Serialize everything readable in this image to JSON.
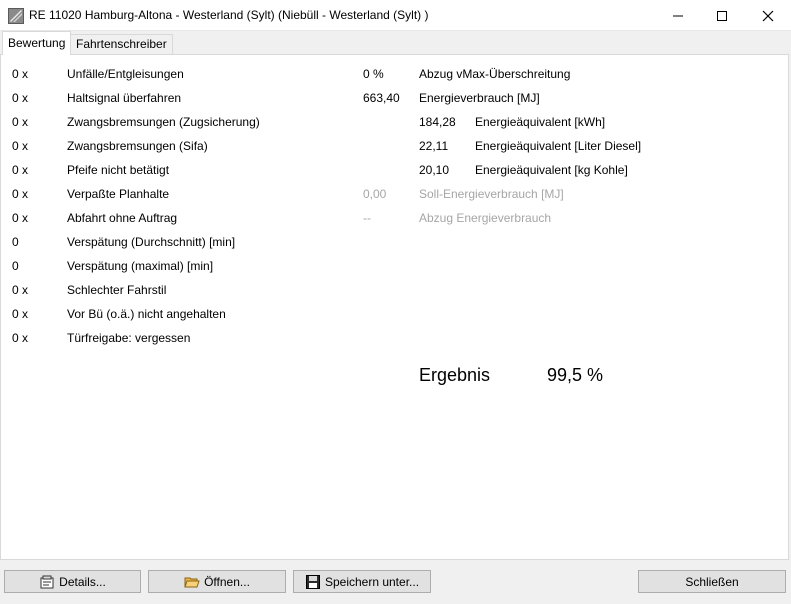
{
  "window": {
    "title": "RE 11020 Hamburg-Altona - Westerland (Sylt) (Niebüll - Westerland (Sylt) )"
  },
  "tabs": [
    {
      "label": "Bewertung",
      "active": true
    },
    {
      "label": "Fahrtenschreiber",
      "active": false
    }
  ],
  "left_rows": [
    {
      "count": "0 x",
      "label": "Unfälle/Entgleisungen"
    },
    {
      "count": "0 x",
      "label": "Haltsignal überfahren"
    },
    {
      "count": "0 x",
      "label": "Zwangsbremsungen (Zugsicherung)"
    },
    {
      "count": "0 x",
      "label": "Zwangsbremsungen (Sifa)"
    },
    {
      "count": "0 x",
      "label": "Pfeife nicht betätigt"
    },
    {
      "count": "0 x",
      "label": "Verpaßte Planhalte"
    },
    {
      "count": "0 x",
      "label": "Abfahrt ohne Auftrag"
    },
    {
      "count": "0",
      "label": "Verspätung (Durchschnitt) [min]"
    },
    {
      "count": "0",
      "label": "Verspätung (maximal) [min]"
    },
    {
      "count": "0 x",
      "label": "Schlechter Fahrstil"
    },
    {
      "count": "0 x",
      "label": "Vor Bü (o.ä.) nicht angehalten"
    },
    {
      "count": "0 x",
      "label": "Türfreigabe: vergessen"
    }
  ],
  "right_rows": [
    {
      "value": "0 %",
      "label": "Abzug vMax-Überschreitung",
      "disabled": false
    },
    {
      "value": "663,40",
      "label": "Energieverbrauch [MJ]",
      "disabled": false
    },
    {
      "value": "",
      "sub_value": "184,28",
      "label": "Energieäquivalent [kWh]",
      "disabled": false
    },
    {
      "value": "",
      "sub_value": "22,11",
      "label": "Energieäquivalent [Liter Diesel]",
      "disabled": false
    },
    {
      "value": "",
      "sub_value": "20,10",
      "label": "Energieäquivalent [kg Kohle]",
      "disabled": false
    },
    {
      "value": "0,00",
      "label": "Soll-Energieverbrauch [MJ]",
      "disabled": true
    },
    {
      "value": "--",
      "label": "Abzug Energieverbrauch",
      "disabled": true
    }
  ],
  "result": {
    "label": "Ergebnis",
    "value": "99,5 %"
  },
  "buttons": {
    "details": "Details...",
    "open": "Öffnen...",
    "save": "Speichern unter...",
    "close": "Schließen"
  },
  "icons": {
    "app": "app-logo-icon",
    "details": "details-icon",
    "open": "folder-open-icon",
    "save": "floppy-disk-icon"
  }
}
